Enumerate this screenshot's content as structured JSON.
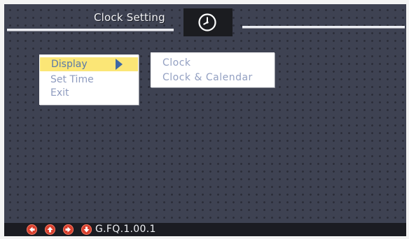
{
  "header": {
    "title": "Clock Setting",
    "icon": "clock-icon"
  },
  "main_menu": {
    "items": [
      {
        "label": "Display",
        "selected": true
      },
      {
        "label": "Set Time",
        "selected": false
      },
      {
        "label": "Exit",
        "selected": false
      }
    ]
  },
  "sub_menu": {
    "items": [
      {
        "label": "Clock"
      },
      {
        "label": "Clock & Calendar"
      }
    ]
  },
  "footer": {
    "nav_icons": [
      "arrow-left-icon",
      "arrow-up-icon",
      "arrow-right-icon",
      "arrow-down-icon"
    ],
    "version": "G.FQ.1.00.1"
  },
  "colors": {
    "background": "#3e4252",
    "selection": "#fbe676",
    "menu_text": "#8e9bbf",
    "nav_button": "#d9402e"
  }
}
